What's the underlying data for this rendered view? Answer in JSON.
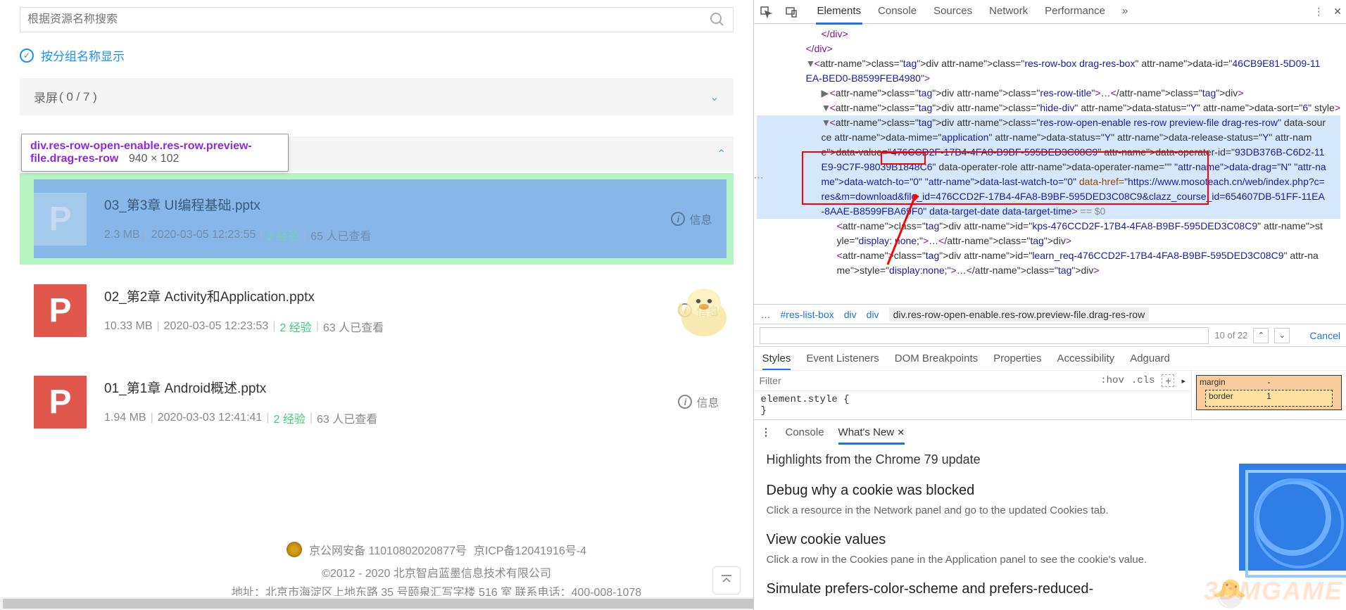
{
  "search": {
    "placeholder": "根据资源名称搜索"
  },
  "groupToggle": {
    "label": "按分组名称显示"
  },
  "section1": {
    "title": "录屏",
    "counter": "( 0 / 7 )"
  },
  "tooltip": {
    "selector": "div.res-row-open-enable.res-row.preview-file.drag-res-row",
    "dims": "940 × 102"
  },
  "files": [
    {
      "name": "03_第3章 UI编程基础.pptx",
      "size": "2.3 MB",
      "date": "2020-03-05 12:23:55",
      "credit": "2 经验",
      "views": "65 人已查看",
      "info": "信息",
      "icon": "P"
    },
    {
      "name": "02_第2章 Activity和Application.pptx",
      "size": "10.33 MB",
      "date": "2020-03-05 12:23:53",
      "credit": "2 经验",
      "views": "63 人已查看",
      "info": "信息",
      "icon": "P"
    },
    {
      "name": "01_第1章 Android概述.pptx",
      "size": "1.94 MB",
      "date": "2020-03-03 12:41:41",
      "credit": "2 经验",
      "views": "63 人已查看",
      "info": "信息",
      "icon": "P"
    }
  ],
  "footer": {
    "line1a": "京公网安备 11010802020877号",
    "line1b": "京ICP备12041916号-4",
    "line2": "©2012 - 2020 北京智启蓝墨信息技术有限公司",
    "line3": "地址：北京市海淀区上地东路 35 号颐泉汇写字楼 516 室    联系电话：400-008-1078"
  },
  "devtools": {
    "tabs": [
      "Elements",
      "Console",
      "Sources",
      "Network",
      "Performance"
    ],
    "activeTab": "Elements",
    "dom": {
      "l0": "</div>",
      "l1": "</div>",
      "l2_open": "<div class=\"res-row-box drag-res-box\" data-id=\"46CB9E81-5D09-11EA-BED0-B8599FEB4980\">",
      "l3": "<div class=\"res-row-title\">…</div>",
      "l4": "<div class=\"hide-div\" data-status=\"Y\" data-sort=\"6\" style>",
      "l5_pre": "<div class=\"res-row-open-enable res-row preview-file  drag-res-row\" data-source data-mime=\"application\" data-status=\"Y\" data-release-status=\"Y\" data-value=\"476CCD2F-17B4-4FA8-B9BF-595DED3C08C9\" data-operater-id=\"93DB376B-C6D2-11E9-9C7F-98039B1848C6\" data-operater-role data-operater-name=\"",
      "l5_mid": "\" data-drag=\"N\" data-watch-to=\"0\" data-last-watch-to=\"0\" ",
      "l5_href_key": "data-href=",
      "l5_href_val": "\"https://www.mosoteach.cn/web/index.php?c=res&m=download&file_id=476CCD2F-17B4-4FA8-B9BF-595DED3C08C9&clazz_course_id=654607DB-51FF-11EA-8AAE-B8599FBA69F0\"",
      "l5_post": " data-target-date data-target-time>",
      "l5_eq": " == $0",
      "l6": "<div id=\"kps-476CCD2F-17B4-4FA8-B9BF-595DED3C08C9\" style=\"display: none;\">…</div>",
      "l7": "<div id=\"learn_req-476CCD2F-17B4-4FA8-B9BF-595DED3C08C9\" style=\"display:none;\">…</div>"
    },
    "breadcrumb": {
      "ellipsis": "…",
      "b1": "#res-list-box",
      "b2": "div",
      "b3": "div",
      "b4": "div.res-row-open-enable.res-row.preview-file.drag-res-row"
    },
    "searchBar": {
      "count": "10 of 22",
      "cancel": "Cancel"
    },
    "styleTabs": [
      "Styles",
      "Event Listeners",
      "DOM Breakpoints",
      "Properties",
      "Accessibility",
      "Adguard"
    ],
    "activeStyleTab": "Styles",
    "filterPlaceholder": "Filter",
    "hov": ":hov",
    "cls": ".cls",
    "styleRule": "element.style {\n}",
    "boxModel": {
      "margin": "margin",
      "mdash": "-",
      "border": "border",
      "bnum": "1"
    },
    "drawer": {
      "tabs": [
        "Console",
        "What's New"
      ],
      "active": "What's New",
      "heading": "Highlights from the Chrome 79 update",
      "s1_title": "Debug why a cookie was blocked",
      "s1_desc": "Click a resource in the Network panel and go to the updated Cookies tab.",
      "s2_title": "View cookie values",
      "s2_desc": "Click a row in the Cookies pane in the Application panel to see the cookie's value.",
      "s3_title": "Simulate prefers-color-scheme and prefers-reduced-"
    }
  },
  "watermark": "3DMGAME"
}
